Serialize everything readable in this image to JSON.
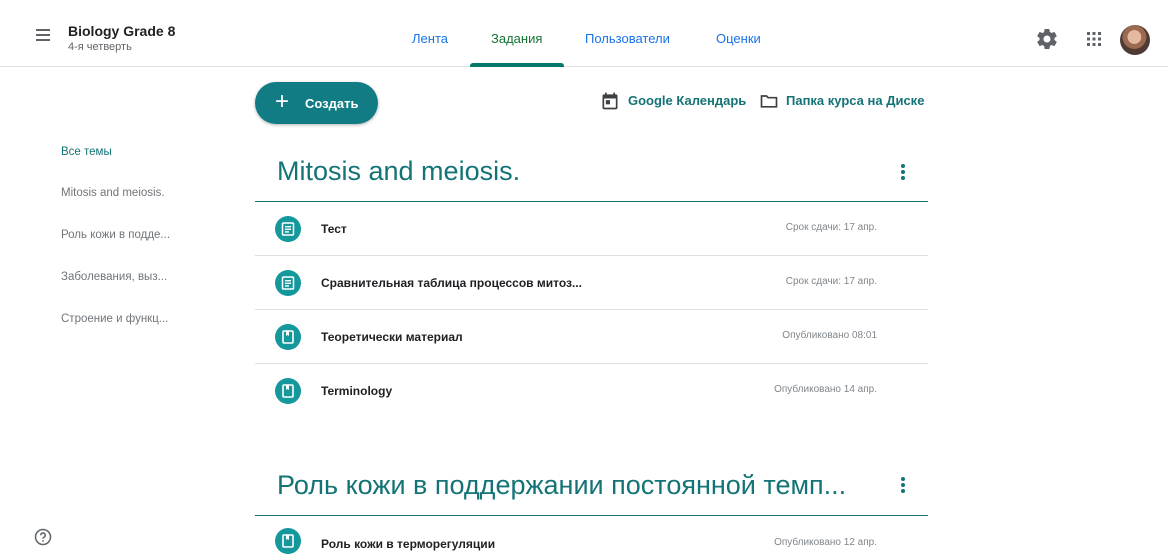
{
  "header": {
    "course_title": "Biology Grade 8",
    "course_subtitle": "4-я четверть",
    "tabs": [
      {
        "label": "Лента"
      },
      {
        "label": "Задания"
      },
      {
        "label": "Пользователи"
      },
      {
        "label": "Оценки"
      }
    ],
    "active_tab": "Задания",
    "icons": [
      "menu-icon",
      "settings-icon",
      "apps-grid-icon",
      "avatar"
    ]
  },
  "toolbar": {
    "create_label": "Создать",
    "calendar_link": "Google Календарь",
    "drive_link": "Папка курса на Диске"
  },
  "sidebar": {
    "items": [
      {
        "label": "Все темы"
      },
      {
        "label": "Mitosis and meiosis."
      },
      {
        "label": "Роль кожи в подде..."
      },
      {
        "label": "Заболевания, выз..."
      },
      {
        "label": "Строение и функц..."
      }
    ]
  },
  "topics": [
    {
      "title": "Mitosis and meiosis.",
      "items": [
        {
          "title": "Тест",
          "meta": "Срок сдачи: 17 апр.",
          "icon": "assignment-icon"
        },
        {
          "title": "Сравнительная таблица процессов митоз...",
          "meta": "Срок сдачи: 17 апр.",
          "icon": "assignment-icon"
        },
        {
          "title": "Теоретически материал",
          "meta": "Опубликовано 08:01",
          "icon": "material-icon"
        },
        {
          "title": "Terminology",
          "meta": "Опубликовано 14 апр.",
          "icon": "material-icon"
        }
      ]
    },
    {
      "title": "Роль кожи в поддержании постоянной темп...",
      "items": [
        {
          "title": "Роль кожи в терморегуляции",
          "meta": "Опубликовано 12 апр.",
          "icon": "material-icon"
        }
      ]
    }
  ],
  "colors": {
    "accent": "#137376",
    "icon_bg": "#14989c",
    "tab_link": "#1a73e8"
  }
}
